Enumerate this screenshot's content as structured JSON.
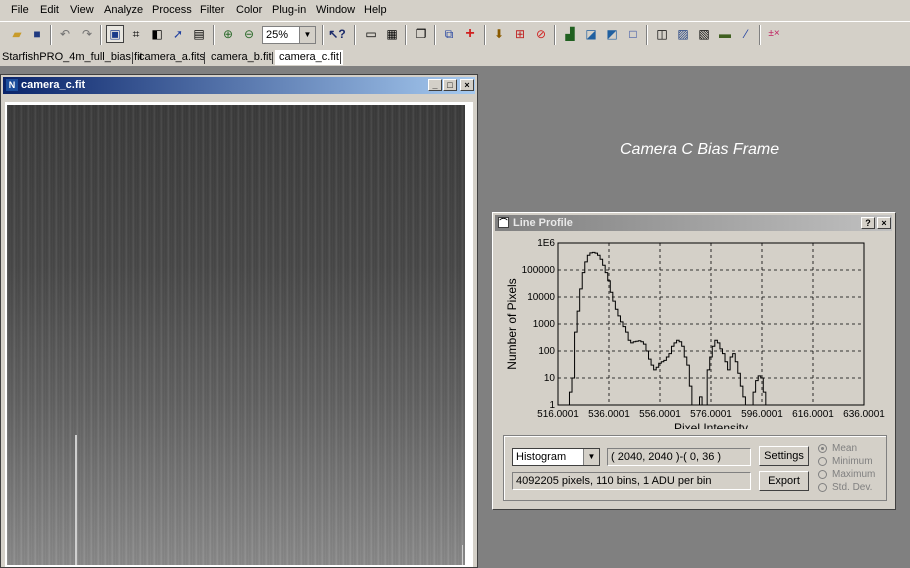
{
  "menu": [
    "File",
    "Edit",
    "View",
    "Analyze",
    "Process",
    "Filter",
    "Color",
    "Plug-in",
    "Window",
    "Help"
  ],
  "toolbar": {
    "zoom": "25%"
  },
  "tabs": [
    "StarfishPRO_4m_full_bias.fit",
    "camera_a.fits",
    "camera_b.fit",
    "camera_c.fit"
  ],
  "image_window": {
    "title": "camera_c.fit"
  },
  "caption": "Camera C Bias Frame",
  "dialog": {
    "title": "Line Profile",
    "mode": "Histogram",
    "coords": "( 2040, 2040 )-( 0, 36 )",
    "stats": "4092205 pixels, 110 bins, 1 ADU per bin",
    "settings_label": "Settings",
    "export_label": "Export",
    "radios": [
      "Mean",
      "Minimum",
      "Maximum",
      "Std. Dev."
    ]
  },
  "chart_data": {
    "type": "line",
    "xlabel": "Pixel Intensity",
    "ylabel": "Number of Pixels",
    "xlim": [
      516.0001,
      636.0001
    ],
    "xticks": [
      "516.0001",
      "536.0001",
      "556.0001",
      "576.0001",
      "596.0001",
      "616.0001",
      "636.0001"
    ],
    "yscale": "log",
    "ylim": [
      1,
      1000000
    ],
    "yticks": [
      "1",
      "10",
      "100",
      "1000",
      "10000",
      "100000",
      "1E6"
    ],
    "grid": true,
    "series": [
      {
        "x": [
          521,
          522,
          523,
          524,
          525,
          526,
          527,
          528,
          529,
          530,
          531,
          532,
          533,
          534,
          535,
          536,
          537,
          538,
          539,
          540,
          541,
          542,
          543,
          544,
          545,
          546,
          547,
          548,
          549,
          550,
          551,
          552,
          553,
          554,
          555,
          556,
          557,
          558,
          559,
          560,
          561,
          562,
          563,
          564,
          565,
          566,
          567,
          568,
          569,
          570,
          571,
          572,
          573,
          574,
          575,
          576,
          577,
          578,
          579,
          580,
          581,
          582,
          583,
          584,
          585,
          586,
          587,
          588,
          589,
          590,
          591,
          592,
          593,
          594,
          595,
          596,
          597,
          598,
          599,
          600,
          601,
          602,
          603,
          604,
          605,
          606,
          607,
          608,
          609,
          610,
          611,
          612,
          613,
          614,
          615,
          616,
          617,
          618,
          619,
          620,
          621,
          622,
          623,
          624,
          625,
          626,
          627,
          628,
          629,
          630,
          631,
          632,
          633,
          634,
          635
        ],
        "y": [
          3,
          10,
          500,
          3000,
          20000,
          80000,
          200000,
          350000,
          430000,
          450000,
          420000,
          350000,
          250000,
          150000,
          80000,
          40000,
          15000,
          7000,
          3500,
          2000,
          1200,
          800,
          500,
          250,
          200,
          220,
          230,
          240,
          220,
          180,
          100,
          50,
          30,
          20,
          25,
          35,
          40,
          45,
          60,
          80,
          150,
          200,
          250,
          220,
          150,
          60,
          30,
          5,
          1,
          1,
          1,
          2,
          1,
          1,
          20,
          60,
          150,
          250,
          200,
          120,
          80,
          40,
          20,
          60,
          80,
          40,
          15,
          5,
          2,
          1,
          1,
          1,
          3,
          8,
          12,
          10,
          3,
          1,
          1,
          1,
          1,
          1,
          1,
          1,
          1,
          1,
          1,
          1,
          1,
          1,
          1,
          1,
          1,
          1,
          1,
          1,
          1,
          1,
          1,
          1,
          1,
          1,
          1,
          1,
          1,
          1,
          1,
          1,
          1,
          1,
          1,
          1,
          1,
          1,
          1
        ]
      }
    ]
  }
}
